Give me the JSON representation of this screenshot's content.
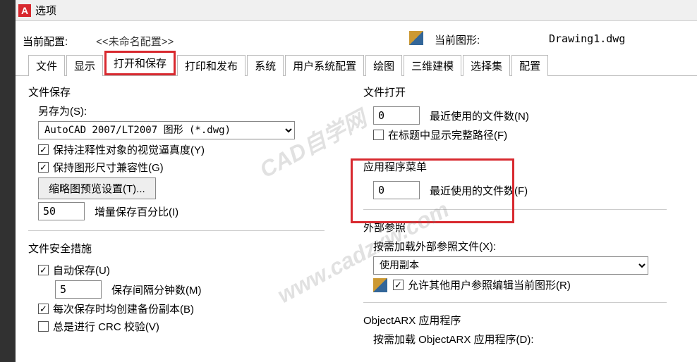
{
  "title": "选项",
  "header": {
    "current_profile_lbl": "当前配置:",
    "current_profile_val": "<<未命名配置>>",
    "current_drawing_lbl": "当前图形:",
    "current_drawing_val": "Drawing1.dwg"
  },
  "tabs": {
    "t0": "文件",
    "t1": "显示",
    "t2": "打开和保存",
    "t3": "打印和发布",
    "t4": "系统",
    "t5": "用户系统配置",
    "t6": "绘图",
    "t7": "三维建模",
    "t8": "选择集",
    "t9": "配置"
  },
  "file_save": {
    "group": "文件保存",
    "saveas": "另存为(S):",
    "format": "AutoCAD 2007/LT2007 图形 (*.dwg)",
    "keep_anno": "保持注释性对象的视觉逼真度(Y)",
    "keep_size": "保持图形尺寸兼容性(G)",
    "thumb_btn": "缩略图预览设置(T)...",
    "incr_val": "50",
    "incr_lbl": "增量保存百分比(I)"
  },
  "file_safety": {
    "group": "文件安全措施",
    "autosave": "自动保存(U)",
    "interval_val": "5",
    "interval_lbl": "保存间隔分钟数(M)",
    "backup": "每次保存时均创建备份副本(B)",
    "crc": "总是进行 CRC 校验(V)"
  },
  "file_open": {
    "group": "文件打开",
    "recent_val": "0",
    "recent_lbl": "最近使用的文件数(N)",
    "fullpath": "在标题中显示完整路径(F)"
  },
  "app_menu": {
    "group": "应用程序菜单",
    "recent_val": "0",
    "recent_lbl": "最近使用的文件数(F)"
  },
  "xref": {
    "group": "外部参照",
    "demand_lbl": "按需加载外部参照文件(X):",
    "mode": "使用副本",
    "allow_edit": "允许其他用户参照编辑当前图形(R)"
  },
  "arx": {
    "group": "ObjectARX 应用程序",
    "demand_lbl": "按需加载 ObjectARX 应用程序(D):"
  },
  "wm1": "CAD自学网",
  "wm2": "www.cadzxw.com"
}
